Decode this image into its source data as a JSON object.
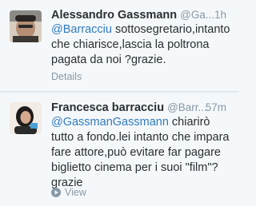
{
  "tweets": [
    {
      "name": "Alessandro Gassmann",
      "handle": "@Ga...",
      "time": "1h",
      "mention": "@Barracciu",
      "text": " sottosegretario,intanto che chiarisce,lascia la poltrona pagata da noi ?grazie.",
      "footer": "Details"
    },
    {
      "name": "Francesca barracciu",
      "handle": "@Barr...",
      "time": "57m",
      "mention": "@GassmanGassmann",
      "text": " chiarirò tutto a fondo.lei intanto che impara fare attore,può evitare far pagare biglietto cinema per i suoi \"film\"? grazie",
      "footer": "View"
    }
  ],
  "colors": {
    "link": "#2f7bbf",
    "text": "#292f33",
    "muted": "#8899a6"
  }
}
